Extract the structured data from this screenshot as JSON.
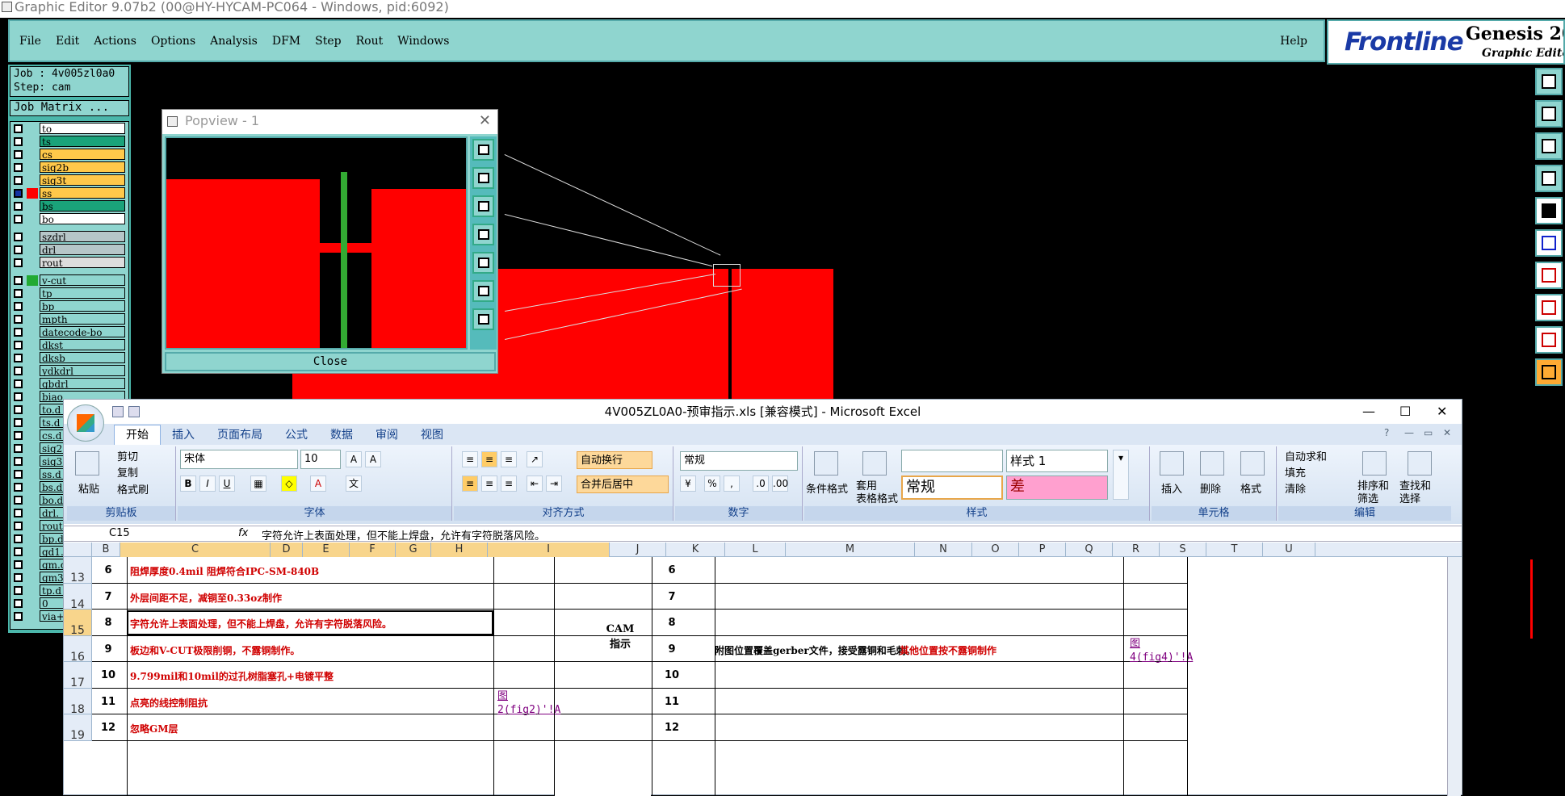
{
  "genesis": {
    "title": "Graphic Editor 9.07b2 (00@HY-HYCAM-PC064 - Windows, pid:6092)",
    "menu": [
      "File",
      "Edit",
      "Actions",
      "Options",
      "Analysis",
      "DFM",
      "Step",
      "Rout",
      "Windows"
    ],
    "help": "Help",
    "logo": {
      "brand": "Frontline",
      "product": "Genesis 2000",
      "sub": "Graphic Editor"
    },
    "job": "Job : 4v005zl0a0",
    "step": "Step: cam",
    "job_matrix": "Job Matrix ...",
    "layers": [
      {
        "name": "to",
        "color": "#ffffff"
      },
      {
        "name": "ts",
        "color": "#1aa37a"
      },
      {
        "name": "cs",
        "color": "#ffc84a"
      },
      {
        "name": "sig2b",
        "color": "#ffc84a"
      },
      {
        "name": "sig3t",
        "color": "#ffc84a"
      },
      {
        "name": "ss",
        "color": "#ffc84a",
        "active": true
      },
      {
        "name": "bs",
        "color": "#1aa37a"
      },
      {
        "name": "bo",
        "color": "#ffffff"
      },
      {
        "sep": true
      },
      {
        "name": "szdrl",
        "color": "#b6c6c8"
      },
      {
        "name": "drl",
        "color": "#b6c6c8"
      },
      {
        "name": "rout",
        "color": "#dddddd"
      },
      {
        "sep": true
      },
      {
        "name": "v-cut",
        "color": "#8fd5cf"
      },
      {
        "name": "tp",
        "color": "#8fd5cf"
      },
      {
        "name": "bp",
        "color": "#8fd5cf"
      },
      {
        "name": "mpth",
        "color": "#8fd5cf"
      },
      {
        "name": "datecode-bo",
        "color": "#8fd5cf"
      },
      {
        "name": "dkst",
        "color": "#8fd5cf"
      },
      {
        "name": "dksb",
        "color": "#8fd5cf"
      },
      {
        "name": "ydkdrl",
        "color": "#8fd5cf"
      },
      {
        "name": "gbdrl",
        "color": "#8fd5cf"
      },
      {
        "name": "biao",
        "color": "#8fd5cf"
      },
      {
        "name": "to.d",
        "color": "#8fd5cf"
      },
      {
        "name": "ts.d",
        "color": "#8fd5cf"
      },
      {
        "name": "cs.d",
        "color": "#8fd5cf"
      },
      {
        "name": "sig2",
        "color": "#8fd5cf"
      },
      {
        "name": "sig3",
        "color": "#8fd5cf"
      },
      {
        "name": "ss.d",
        "color": "#8fd5cf"
      },
      {
        "name": "bs.d",
        "color": "#8fd5cf"
      },
      {
        "name": "bo.d",
        "color": "#8fd5cf"
      },
      {
        "name": "drl.",
        "color": "#8fd5cf"
      },
      {
        "name": "rout",
        "color": "#8fd5cf"
      },
      {
        "name": "bp.d",
        "color": "#8fd5cf"
      },
      {
        "name": "gd1.",
        "color": "#8fd5cf"
      },
      {
        "name": "gm.d",
        "color": "#8fd5cf"
      },
      {
        "name": "gm3.",
        "color": "#8fd5cf"
      },
      {
        "name": "tp.d",
        "color": "#8fd5cf"
      },
      {
        "name": "0",
        "color": "#8fd5cf"
      },
      {
        "name": "via+",
        "color": "#8fd5cf"
      }
    ]
  },
  "popview": {
    "title": "Popview - 1",
    "close": "Close"
  },
  "excel": {
    "title": "4V005ZL0A0-预审指示.xls  [兼容模式] - Microsoft Excel",
    "tabs": [
      "开始",
      "插入",
      "页面布局",
      "公式",
      "数据",
      "审阅",
      "视图"
    ],
    "clipboard": {
      "paste": "粘贴",
      "cut": "剪切",
      "copy": "复制",
      "format_painter": "格式刷",
      "label": "剪贴板"
    },
    "font": {
      "name": "宋体",
      "size": "10",
      "label": "字体",
      "bold": "B",
      "italic": "I",
      "underline": "U"
    },
    "alignment": {
      "wrap": "自动换行",
      "merge": "合并后居中",
      "label": "对齐方式"
    },
    "number": {
      "format": "常规",
      "label": "数字"
    },
    "styles": {
      "cond": "条件格式",
      "table": "套用\n表格格式",
      "style1": "样式 1",
      "normal": "常规",
      "bad": "差",
      "label": "样式"
    },
    "cells": {
      "insert": "插入",
      "delete": "删除",
      "format": "格式",
      "label": "单元格"
    },
    "editing": {
      "autosum": "自动求和",
      "fill": "填充",
      "clear": "清除",
      "sort": "排序和\n筛选",
      "find": "查找和\n选择",
      "label": "编辑"
    },
    "name_box": "C15",
    "fx": "fx",
    "formula": "字符允许上表面处理，但不能上焊盘，允许有字符脱落风险。",
    "columns": [
      "B",
      "C",
      "D",
      "E",
      "F",
      "G",
      "H",
      "I",
      "J",
      "K",
      "L",
      "M",
      "N",
      "O",
      "P",
      "Q",
      "R",
      "S",
      "T",
      "U"
    ],
    "rows": [
      {
        "row": "13",
        "num": "6",
        "text": "阻焊厚度0.4mil  阻焊符合IPC-SM-840B",
        "lnum": "6",
        "ltext": "",
        "link": "",
        "tlink": ""
      },
      {
        "row": "14",
        "num": "7",
        "text": "外层间距不足，减铜至0.33oz制作",
        "lnum": "7",
        "ltext": "",
        "link": "",
        "tlink": ""
      },
      {
        "row": "15",
        "num": "8",
        "text": "字符允许上表面处理，但不能上焊盘，允许有字符脱落风险。",
        "lnum": "8",
        "ltext": "",
        "link": "",
        "tlink": ""
      },
      {
        "row": "16",
        "num": "9",
        "text": "板边和V-CUT极限削铜，不露铜制作。",
        "lnum": "9",
        "ltext": "附图位置覆盖gerber文件，接受露铜和毛刺。",
        "ltext_red": "其他位置按不露铜制作",
        "link": "",
        "tlink": "图\n4(fig4)'!A"
      },
      {
        "row": "17",
        "num": "10",
        "text": "9.799mil和10mil的过孔树脂塞孔+电镀平整",
        "lnum": "10",
        "ltext": "",
        "link": "",
        "tlink": ""
      },
      {
        "row": "18",
        "num": "11",
        "text": "点亮的线控制阻抗",
        "lnum": "11",
        "ltext": "",
        "link": "图\n2(fig2)'!A",
        "tlink": ""
      },
      {
        "row": "19",
        "num": "12",
        "text": "忽略GM层",
        "lnum": "12",
        "ltext": "",
        "link": "",
        "tlink": ""
      }
    ],
    "cam_label": "CAM\n指示"
  }
}
